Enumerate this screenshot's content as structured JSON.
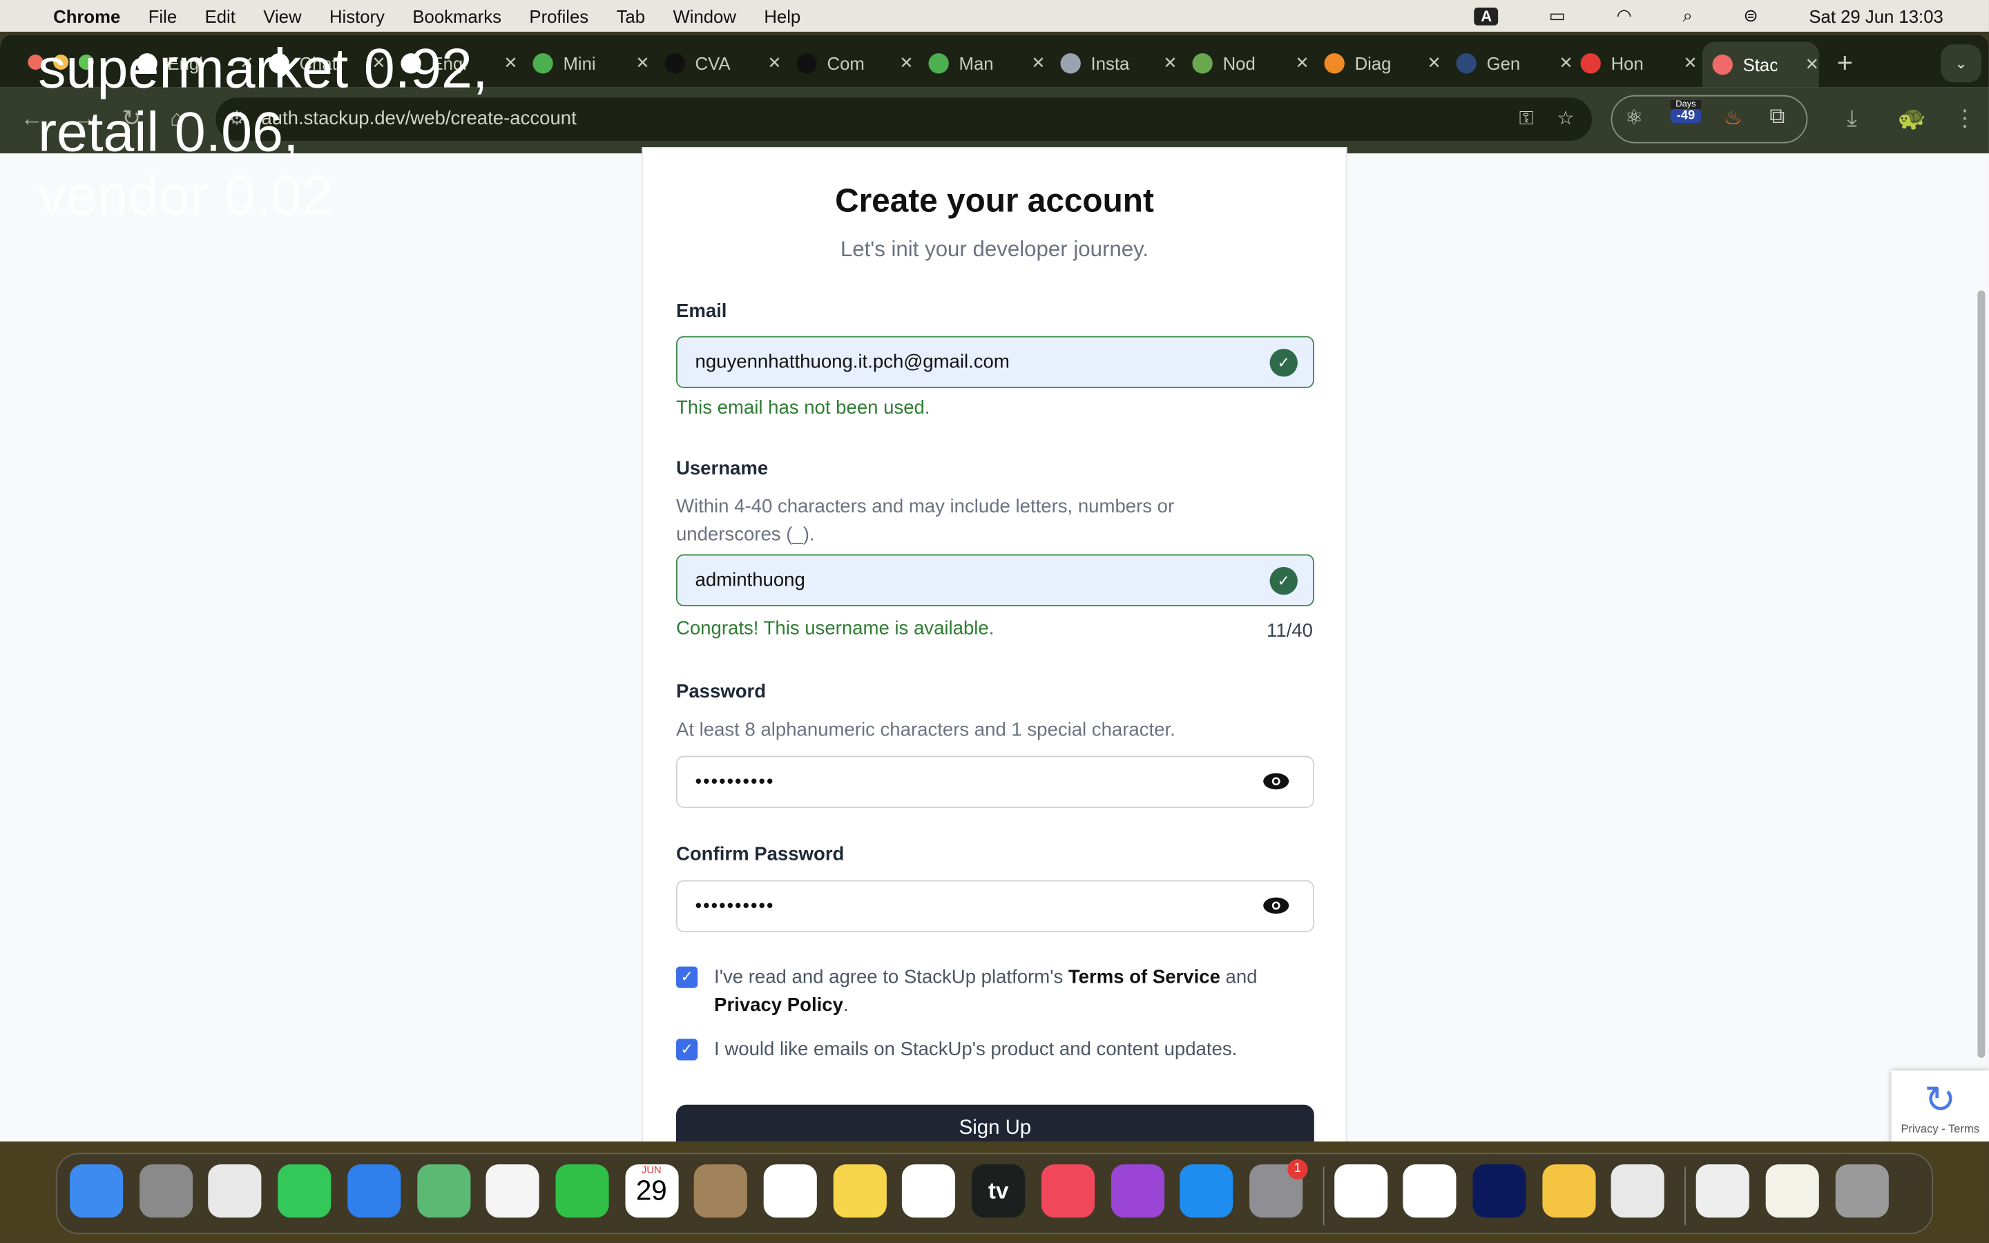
{
  "menubar": {
    "app": "Chrome",
    "items": [
      "File",
      "Edit",
      "View",
      "History",
      "Bookmarks",
      "Profiles",
      "Tab",
      "Window",
      "Help"
    ],
    "datetime": "Sat 29 Jun  13:03",
    "input_source": "A"
  },
  "tabs": [
    {
      "title": "Engl",
      "color": "#ffffff"
    },
    {
      "title": "Chat",
      "color": "#ffffff"
    },
    {
      "title": "Engl",
      "color": "#ffffff"
    },
    {
      "title": "Mini",
      "color": "#4caf50"
    },
    {
      "title": "CVA",
      "color": "#111111"
    },
    {
      "title": "Com",
      "color": "#111111"
    },
    {
      "title": "Man",
      "color": "#4caf50"
    },
    {
      "title": "Insta",
      "color": "#9aa4b1"
    },
    {
      "title": "Nod",
      "color": "#6aa84f"
    },
    {
      "title": "Diag",
      "color": "#f08a24"
    },
    {
      "title": "Gen",
      "color": "#2d4a7a"
    },
    {
      "title": "Hon",
      "color": "#e53935"
    },
    {
      "title": "Stac",
      "color": "#f06a6a",
      "active": true
    }
  ],
  "toolbar": {
    "url": "auth.stackup.dev/web/create-account",
    "days_label": "Days",
    "days_value": "-49"
  },
  "overlay": {
    "line1": "supermarket 0.92,",
    "line2": "retail 0.06,",
    "line3": "vendor 0.02"
  },
  "form": {
    "title": "Create your account",
    "subtitle": "Let's init your developer journey.",
    "email_label": "Email",
    "email_value": "nguyennhatthuong.it.pch@gmail.com",
    "email_msg": "This email has not been used.",
    "username_label": "Username",
    "username_hint": "Within 4-40 characters and may include letters, numbers or underscores (_).",
    "username_value": "adminthuong",
    "username_msg": "Congrats! This username is available.",
    "username_count": "11/40",
    "password_label": "Password",
    "password_hint": "At least 8 alphanumeric characters and 1 special character.",
    "password_value": "••••••••••",
    "confirm_label": "Confirm Password",
    "confirm_value": "••••••••••",
    "terms_pre": "I've read and agree to StackUp platform's ",
    "terms_link": "Terms of Service",
    "terms_and": " and",
    "privacy_link": "Privacy Policy",
    "terms_end": ".",
    "terms_checked": true,
    "updates_text": "I would like emails on StackUp's product and content updates.",
    "updates_checked": true,
    "signup": "Sign Up"
  },
  "recaptcha": {
    "text": "Privacy - Terms"
  },
  "dock": [
    {
      "name": "finder",
      "color": "#3d8bf0"
    },
    {
      "name": "launchpad",
      "color": "#8a8a8a"
    },
    {
      "name": "chrome",
      "color": "#e8e8e8"
    },
    {
      "name": "messages",
      "color": "#34c759"
    },
    {
      "name": "mail",
      "color": "#2f80ed"
    },
    {
      "name": "maps",
      "color": "#5bb974"
    },
    {
      "name": "photos",
      "color": "#f5f5f5"
    },
    {
      "name": "facetime",
      "color": "#30c048"
    },
    {
      "name": "calendar",
      "color": "#ffffff",
      "month": "JUN",
      "day": "29"
    },
    {
      "name": "contacts",
      "color": "#a0835a"
    },
    {
      "name": "reminders",
      "color": "#ffffff"
    },
    {
      "name": "notes",
      "color": "#f7d54a"
    },
    {
      "name": "freeform",
      "color": "#ffffff"
    },
    {
      "name": "tv",
      "color": "#1b1f1e",
      "label": "tv"
    },
    {
      "name": "music",
      "color": "#f0475b"
    },
    {
      "name": "podcasts",
      "color": "#9b45d6"
    },
    {
      "name": "app-store",
      "color": "#1f8cf0"
    },
    {
      "name": "system-settings",
      "color": "#8e8e93",
      "badge": "1"
    },
    {
      "name": "vscode",
      "color": "#ffffff"
    },
    {
      "name": "script-editor",
      "color": "#ffffff"
    },
    {
      "name": "teamviewer",
      "color": "#0a1a5c"
    },
    {
      "name": "star-app",
      "color": "#f5c542"
    },
    {
      "name": "chrome-2",
      "color": "#e8e8e8"
    },
    {
      "name": "screenshot",
      "color": "#eeeeee"
    },
    {
      "name": "document",
      "color": "#f2f2e8"
    },
    {
      "name": "trash",
      "color": "#9a9a9a"
    }
  ]
}
